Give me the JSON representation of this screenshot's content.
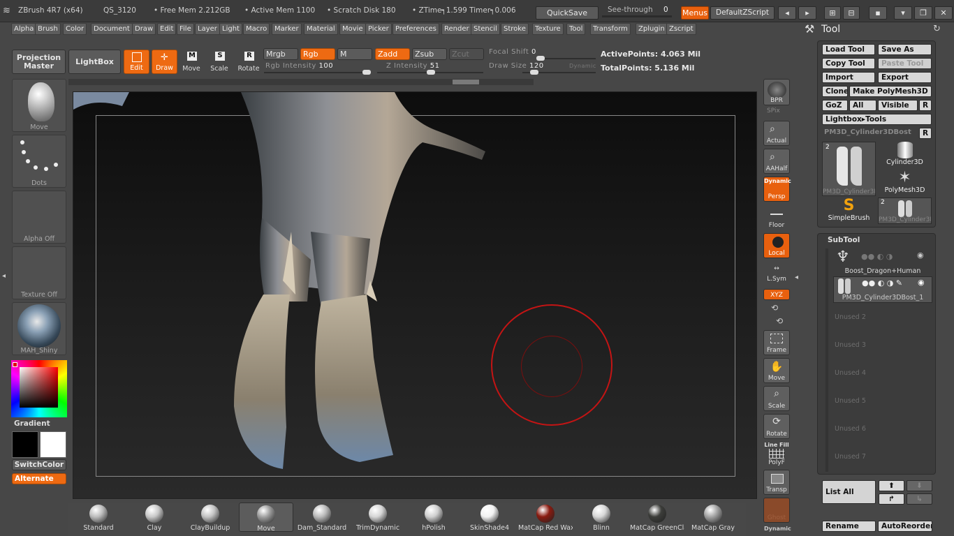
{
  "titlebar": {
    "app": "ZBrush 4R7 (x64)",
    "qs": "QS_3120",
    "free_mem": "• Free Mem 2.212GB",
    "active_mem": "• Active Mem 1100",
    "scratch": "• Scratch Disk 180",
    "ztime": "• ZTime┑1.599 Timer┑0.006",
    "quicksave": "QuickSave",
    "see_through": "See-through",
    "see_through_val": "0",
    "menus": "Menus",
    "script": "DefaultZScript"
  },
  "menubar": [
    "Alpha",
    "Brush",
    "Color",
    "Document",
    "Draw",
    "Edit",
    "File",
    "Layer",
    "Light",
    "Macro",
    "Marker",
    "Material",
    "Movie",
    "Picker",
    "Preferences",
    "Render",
    "Stencil",
    "Stroke",
    "Texture",
    "Tool",
    "Transform",
    "Zplugin",
    "Zscript"
  ],
  "shelf": {
    "projection_master": "Projection Master",
    "lightbox": "LightBox",
    "edit": "Edit",
    "draw": "Draw",
    "move": "Move",
    "scale": "Scale",
    "rotate": "Rotate",
    "mrgb": "Mrgb",
    "rgb": "Rgb",
    "m": "M",
    "zadd": "Zadd",
    "zsub": "Zsub",
    "zcut": "Zcut",
    "rgb_intensity_label": "Rgb Intensity",
    "rgb_intensity": "100",
    "z_intensity_label": "Z Intensity",
    "z_intensity": "51",
    "focal_shift_label": "Focal Shift",
    "focal_shift": "0",
    "draw_size_label": "Draw Size",
    "draw_size": "120",
    "dynamic": "Dynamic",
    "active_points": "ActivePoints: 4.063 Mil",
    "total_points": "TotalPoints: 5.136 Mil",
    "rgb_intensity_level": 1.0,
    "z_intensity_level": 0.51,
    "focal_shift_level": 0.0,
    "draw_size_level": 0.12
  },
  "lefttray": {
    "brush": "Move",
    "stroke": "Dots",
    "alpha": "Alpha Off",
    "texture": "Texture Off",
    "material": "MAH_Shiny",
    "gradient": "Gradient",
    "switchcolor": "SwitchColor",
    "alternate": "Alternate"
  },
  "rightshelf": {
    "bpr": "BPR",
    "spix": "SPix",
    "actual": "Actual",
    "aahalf": "AAHalf",
    "dynamic": "Dynamic",
    "persp": "Persp",
    "floor": "Floor",
    "local": "Local",
    "lsym": "L.Sym",
    "xyz": "XYZ",
    "frame": "Frame",
    "move": "Move",
    "scale": "Scale",
    "rotate": "Rotate",
    "linefill": "Line Fill",
    "polyf": "PolyF",
    "transp": "Transp",
    "ghost": "Ghost",
    "dynamic2": "Dynamic"
  },
  "tool": {
    "header": "Tool",
    "load_tool": "Load Tool",
    "save_as": "Save As",
    "copy_tool": "Copy Tool",
    "paste_tool": "Paste Tool",
    "import": "Import",
    "export": "Export",
    "clone": "Clone",
    "make_polymesh": "Make PolyMesh3D",
    "goz": "GoZ",
    "all": "All",
    "visible": "Visible",
    "r": "R",
    "lightbox_tools": "Lightbox▸Tools",
    "current": "PM3D_Cylinder3DBost",
    "r2": "R",
    "thumbs": [
      {
        "name": "PM3D_Cylinder3I",
        "count": "2"
      },
      {
        "name": "Cylinder3D",
        "count": ""
      },
      {
        "name": "PolyMesh3D",
        "count": ""
      },
      {
        "name": "SimpleBrush",
        "count": ""
      },
      {
        "name": "PM3D_Cylinder3I",
        "count": "2"
      }
    ]
  },
  "subtool": {
    "header": "SubTool",
    "items": [
      "Boost_Dragon+Human",
      "PM3D_Cylinder3DBost_1"
    ],
    "unused": [
      "Unused 2",
      "Unused 3",
      "Unused 4",
      "Unused 5",
      "Unused 6",
      "Unused 7"
    ],
    "list_all": "List All",
    "rename": "Rename",
    "autoreorder": "AutoReorder"
  },
  "brushes": [
    "Standard",
    "Clay",
    "ClayBuildup",
    "Move",
    "Dam_Standard",
    "TrimDynamic",
    "hPolish",
    "SkinShade4",
    "MatCap Red Wax",
    "Blinn",
    "MatCap GreenClay",
    "MatCap Gray"
  ],
  "colors": {
    "accent": "#e8600e",
    "panel": "#474747",
    "canvas": "#1a1a1a"
  }
}
